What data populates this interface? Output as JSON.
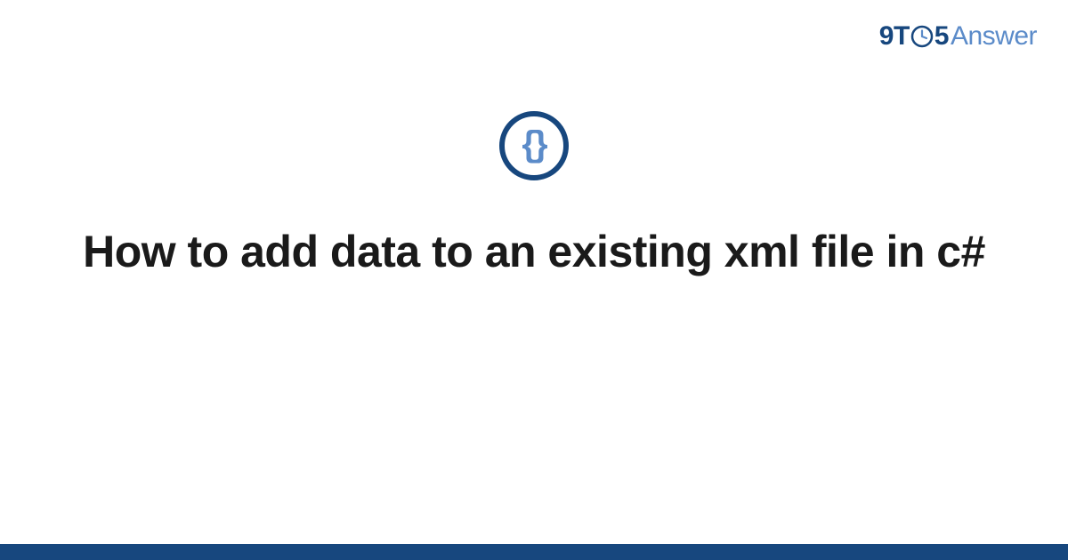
{
  "brand": {
    "nine": "9",
    "t": "T",
    "five": "5",
    "answer": "Answer"
  },
  "icon": {
    "brace_left": "{",
    "brace_right": "}"
  },
  "title": "How to add data to an existing xml file in c#",
  "colors": {
    "primary_dark": "#17477e",
    "primary_light": "#5b8bc9"
  }
}
